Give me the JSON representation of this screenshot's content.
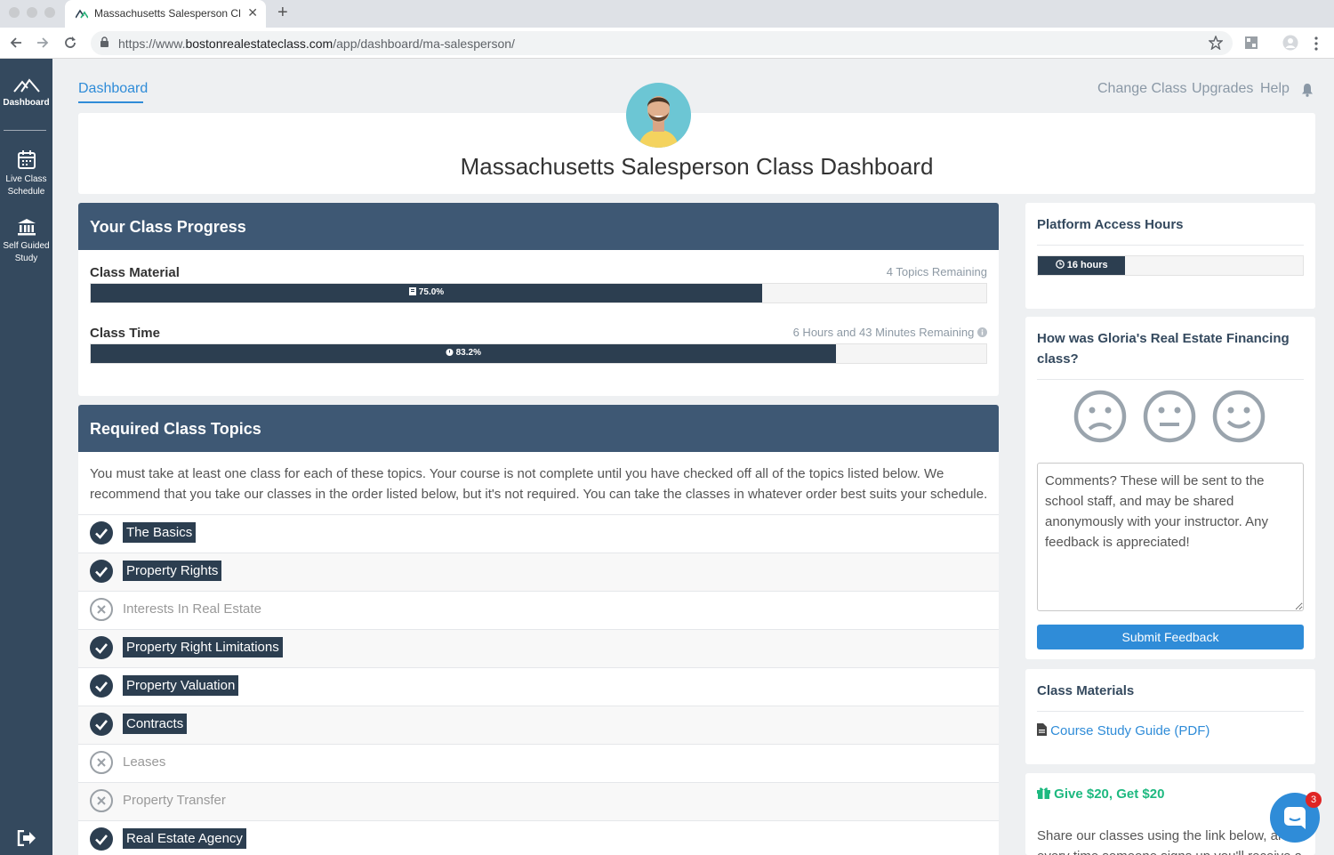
{
  "browser": {
    "tab_title": "Massachusetts Salesperson Class Dashboard",
    "tab_close": "✕",
    "new_tab": "+",
    "url_prefix": "https://www.",
    "url_host": "bostonrealestateclass.com",
    "url_path": "/app/dashboard/ma-salesperson/"
  },
  "sidebar": {
    "items": [
      {
        "label": "Dashboard",
        "icon": "mountain-logo-icon"
      },
      {
        "label": "Live Class Schedule",
        "icon": "calendar-icon"
      },
      {
        "label": "Self Guided Study",
        "icon": "institution-icon"
      }
    ],
    "logout_icon": "sign-out-icon"
  },
  "nav": {
    "breadcrumb": "Dashboard",
    "links": [
      "Change Class",
      "Upgrades",
      "Help"
    ],
    "bell_icon": "bell-icon"
  },
  "header": {
    "title": "Massachusetts Salesperson Class Dashboard"
  },
  "progress": {
    "title": "Your Class Progress",
    "material": {
      "label": "Class Material",
      "remaining": "4 Topics Remaining",
      "percent_text": "75.0%",
      "percent": 75.0
    },
    "time": {
      "label": "Class Time",
      "remaining": "6 Hours and 43 Minutes Remaining",
      "percent_text": "83.2%",
      "percent": 83.2
    }
  },
  "topics": {
    "title": "Required Class Topics",
    "intro": "You must take at least one class for each of these topics. Your course is not complete until you have checked off all of the topics listed below. We recommend that you take our classes in the order listed below, but it's not required. You can take the classes in whatever order best suits your schedule.",
    "items": [
      {
        "label": "The Basics",
        "done": true
      },
      {
        "label": "Property Rights",
        "done": true
      },
      {
        "label": "Interests In Real Estate",
        "done": false
      },
      {
        "label": "Property Right Limitations",
        "done": true
      },
      {
        "label": "Property Valuation",
        "done": true
      },
      {
        "label": "Contracts",
        "done": true
      },
      {
        "label": "Leases",
        "done": false
      },
      {
        "label": "Property Transfer",
        "done": false
      },
      {
        "label": "Real Estate Agency",
        "done": true
      }
    ]
  },
  "access": {
    "title": "Platform Access Hours",
    "value_text": "16 hours",
    "fraction": 0.33
  },
  "feedback": {
    "title": "How was Gloria's Real Estate Financing class?",
    "placeholder": "Comments? These will be sent to the school staff, and may be shared anonymously with your instructor. Any feedback is appreciated!",
    "submit": "Submit Feedback"
  },
  "materials": {
    "title": "Class Materials",
    "link": "Course Study Guide (PDF)"
  },
  "referral": {
    "title": "Give $20, Get $20",
    "text_line1": "Share our classes using the link below, ar",
    "text_line2": "every time someone signs up you'll receive a"
  },
  "chat": {
    "badge": "3"
  },
  "colors": {
    "sidebar": "#34495e",
    "card_header": "#3e5874",
    "accent": "#2f8cd8",
    "progress_fill": "#2c3e50",
    "referral": "#1eb980"
  }
}
